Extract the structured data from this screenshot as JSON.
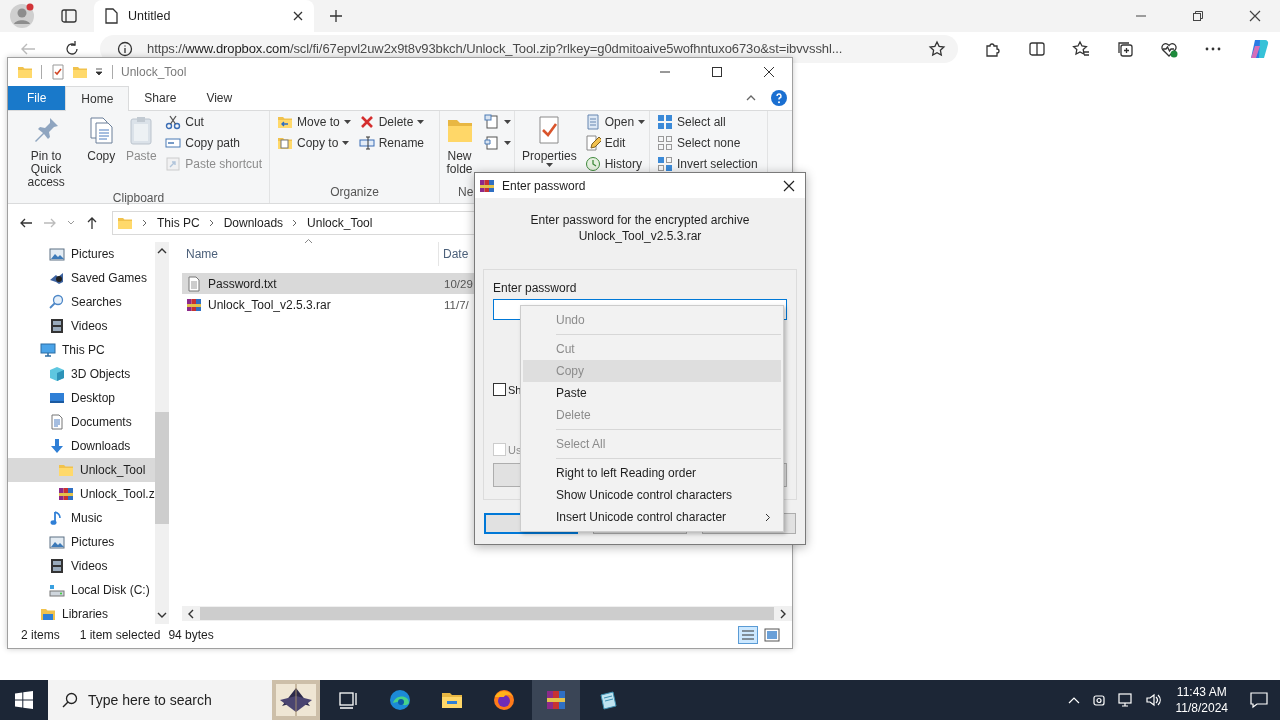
{
  "browser": {
    "tab": {
      "title": "Untitled"
    },
    "url": {
      "scheme": "https://",
      "host": "www.dropbox.com",
      "path": "/scl/fi/67epvl2uw2x9t8v93bkch/Unlock_Tool.zip?rlkey=g0dmitoaive5wofhntuxo673o&st=ibvvsshl..."
    }
  },
  "explorer": {
    "title": "Unlock_Tool",
    "ribbon_tabs": [
      {
        "label": "File",
        "kind": "file",
        "selected": false
      },
      {
        "label": "Home",
        "kind": "tab",
        "selected": true
      },
      {
        "label": "Share",
        "kind": "tab",
        "selected": false
      },
      {
        "label": "View",
        "kind": "tab",
        "selected": false
      }
    ],
    "ribbon_groups": [
      {
        "label": "Clipboard",
        "columns": [
          [
            {
              "label": "Pin to Quick access",
              "kind": "large",
              "disabled": false
            }
          ],
          [
            {
              "label": "Copy",
              "kind": "large",
              "disabled": false
            }
          ],
          [
            {
              "label": "Paste",
              "kind": "large",
              "disabled": true
            }
          ],
          [
            {
              "label": "Cut",
              "kind": "small",
              "disabled": false
            },
            {
              "label": "Copy path",
              "kind": "small",
              "disabled": false
            },
            {
              "label": "Paste shortcut",
              "kind": "small",
              "disabled": true
            }
          ]
        ]
      },
      {
        "label": "Organize",
        "columns": [
          [
            {
              "label": "Move to",
              "kind": "small",
              "disabled": false,
              "dropdown": true
            },
            {
              "label": "Copy to",
              "kind": "small",
              "disabled": false,
              "dropdown": true
            }
          ],
          [
            {
              "label": "Delete",
              "kind": "small",
              "disabled": false,
              "dropdown": true
            },
            {
              "label": "Rename",
              "kind": "small",
              "disabled": false
            }
          ]
        ]
      },
      {
        "label": "Ne",
        "columns": [
          [
            {
              "label": "New folde",
              "kind": "large",
              "disabled": false
            }
          ],
          [
            {
              "kind": "small",
              "disabled": false,
              "dropdown": true
            },
            {
              "kind": "small",
              "disabled": false,
              "dropdown": true
            }
          ]
        ]
      },
      {
        "columns": [
          [
            {
              "label": "Properties",
              "kind": "large",
              "disabled": false,
              "dropdown": true
            }
          ],
          [
            {
              "label": "Open",
              "kind": "small",
              "disabled": false,
              "dropdown": true
            },
            {
              "label": "Edit",
              "kind": "small",
              "disabled": false
            },
            {
              "label": "History",
              "kind": "small",
              "disabled": false
            }
          ]
        ]
      },
      {
        "columns": [
          [
            {
              "label": "Select all",
              "kind": "small",
              "disabled": false
            },
            {
              "label": "Select none",
              "kind": "small",
              "disabled": false
            },
            {
              "label": "Invert selection",
              "kind": "small",
              "disabled": false
            }
          ]
        ]
      }
    ],
    "breadcrumb": [
      "This PC",
      "Downloads",
      "Unlock_Tool"
    ],
    "nav": {
      "items": [
        {
          "children": [
            {
              "label": "Pictures",
              "selected": false
            },
            {
              "label": "Saved Games",
              "selected": false
            },
            {
              "label": "Searches",
              "selected": false
            },
            {
              "label": "Videos",
              "selected": false
            }
          ]
        },
        {
          "label": "This PC",
          "selected": false,
          "children": [
            {
              "label": "3D Objects",
              "selected": false
            },
            {
              "label": "Desktop",
              "selected": false
            },
            {
              "label": "Documents",
              "selected": false
            },
            {
              "label": "Downloads",
              "selected": false,
              "children": [
                {
                  "label": "Unlock_Tool",
                  "selected": true
                },
                {
                  "label": "Unlock_Tool.z",
                  "selected": false
                }
              ]
            },
            {
              "label": "Music",
              "selected": false
            },
            {
              "label": "Pictures",
              "selected": false
            },
            {
              "label": "Videos",
              "selected": false
            },
            {
              "label": "Local Disk (C:)",
              "selected": false
            }
          ]
        },
        {
          "label": "Libraries",
          "selected": false
        }
      ]
    },
    "files": {
      "columns": [
        "Name",
        "Date"
      ],
      "rows": [
        {
          "name": "Password.txt",
          "date": "10/29",
          "kind": "text",
          "selected": true
        },
        {
          "name": "Unlock_Tool_v2.5.3.rar",
          "date": "11/7/",
          "kind": "archive",
          "selected": false
        }
      ]
    },
    "status": [
      "2 items",
      "1 item selected",
      "94 bytes"
    ]
  },
  "dialog": {
    "title": "Enter password",
    "message": [
      "Enter password for the encrypted archive",
      "Unlock_Tool_v2.5.3.rar"
    ],
    "field_label": "Enter password",
    "checkboxes": [
      {
        "label": "Sh",
        "checked": false,
        "disabled": false
      },
      {
        "label": "Us",
        "checked": false,
        "disabled": true
      }
    ]
  },
  "context_menu": {
    "items": [
      {
        "kind": "item",
        "label": "Undo",
        "disabled": true,
        "selected": false
      },
      {
        "kind": "separator"
      },
      {
        "kind": "item",
        "label": "Cut",
        "disabled": true,
        "selected": false
      },
      {
        "kind": "item",
        "label": "Copy",
        "disabled": true,
        "selected": true
      },
      {
        "kind": "item",
        "label": "Paste",
        "disabled": false,
        "selected": false
      },
      {
        "kind": "item",
        "label": "Delete",
        "disabled": true,
        "selected": false
      },
      {
        "kind": "separator"
      },
      {
        "kind": "item",
        "label": "Select All",
        "disabled": true,
        "selected": false
      },
      {
        "kind": "separator"
      },
      {
        "kind": "item",
        "label": "Right to left Reading order",
        "disabled": false,
        "selected": false
      },
      {
        "kind": "item",
        "label": "Show Unicode control characters",
        "disabled": false,
        "selected": false
      },
      {
        "kind": "item",
        "label": "Insert Unicode control character",
        "disabled": false,
        "selected": false,
        "submenu": true
      }
    ]
  },
  "taskbar": {
    "search_placeholder": "Type here to search",
    "apps": [
      {
        "active": false
      },
      {
        "active": false
      },
      {
        "active": false
      },
      {
        "active": false
      },
      {
        "active": true
      },
      {
        "active": false
      }
    ],
    "time": "11:43 AM",
    "date": "11/8/2024"
  }
}
